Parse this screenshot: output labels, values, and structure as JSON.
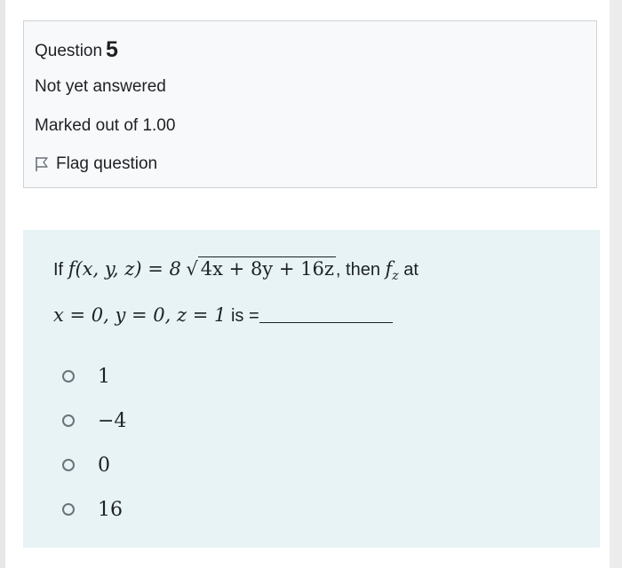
{
  "question": {
    "label": "Question",
    "number": "5",
    "state": "Not yet answered",
    "grade": "Marked out of 1.00",
    "flag_label": "Flag question"
  },
  "text": {
    "if": "If",
    "func": "f(x, y, z) = 8",
    "radicand": "4x + 8y + 16z",
    "then": ", then",
    "fz": "f",
    "fz_sub": "z",
    "at": "at",
    "point": "x = 0, y = 0, z = 1",
    "is": "is ="
  },
  "answers": [
    {
      "label": "1"
    },
    {
      "label": "−4"
    },
    {
      "label": "0"
    },
    {
      "label": "16"
    }
  ],
  "colors": {
    "info_bg": "#f8f9fa",
    "formulation_bg": "#e7f3f5",
    "text": "#1d2125"
  }
}
